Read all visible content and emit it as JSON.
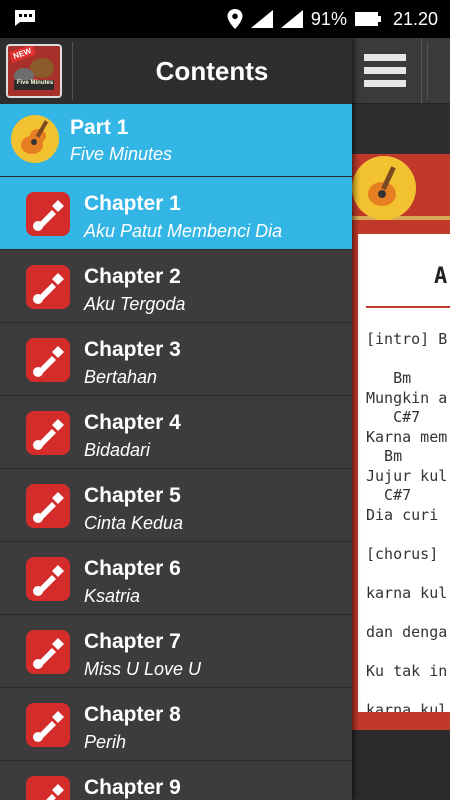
{
  "status_bar": {
    "notification_icon": "bbm-chat-icon",
    "battery_percent": "91%",
    "time": "21.20"
  },
  "drawer": {
    "title": "Contents",
    "app_icon_badge": "NEW",
    "app_icon_text": "Five Minutes",
    "part": {
      "label": "Part 1",
      "subtitle": "Five Minutes"
    },
    "chapters": [
      {
        "label": "Chapter 1",
        "subtitle": "Aku Patut Membenci Dia",
        "active": true
      },
      {
        "label": "Chapter 2",
        "subtitle": "Aku Tergoda"
      },
      {
        "label": "Chapter 3",
        "subtitle": "Bertahan"
      },
      {
        "label": "Chapter 4",
        "subtitle": "Bidadari"
      },
      {
        "label": "Chapter 5",
        "subtitle": "Cinta Kedua"
      },
      {
        "label": "Chapter 6",
        "subtitle": "Ksatria"
      },
      {
        "label": "Chapter 7",
        "subtitle": "Miss U Love U"
      },
      {
        "label": "Chapter 8",
        "subtitle": "Perih"
      },
      {
        "label": "Chapter 9",
        "subtitle": ""
      }
    ]
  },
  "background_content": {
    "title": "A",
    "lyrics": "[intro] B\n\n   Bm\nMungkin a\n   C#7\nKarna mem\n  Bm\nJujur kul\n  C#7\nDia curi\n\n[chorus]\n\nkarna kul\n\ndan denga\n\nKu tak in\n\nkarna kul"
  },
  "colors": {
    "accent": "#33b5e5",
    "chapter_icon": "#d42b2b",
    "banner": "#c0392b",
    "guitar_badge": "#f2c230"
  }
}
